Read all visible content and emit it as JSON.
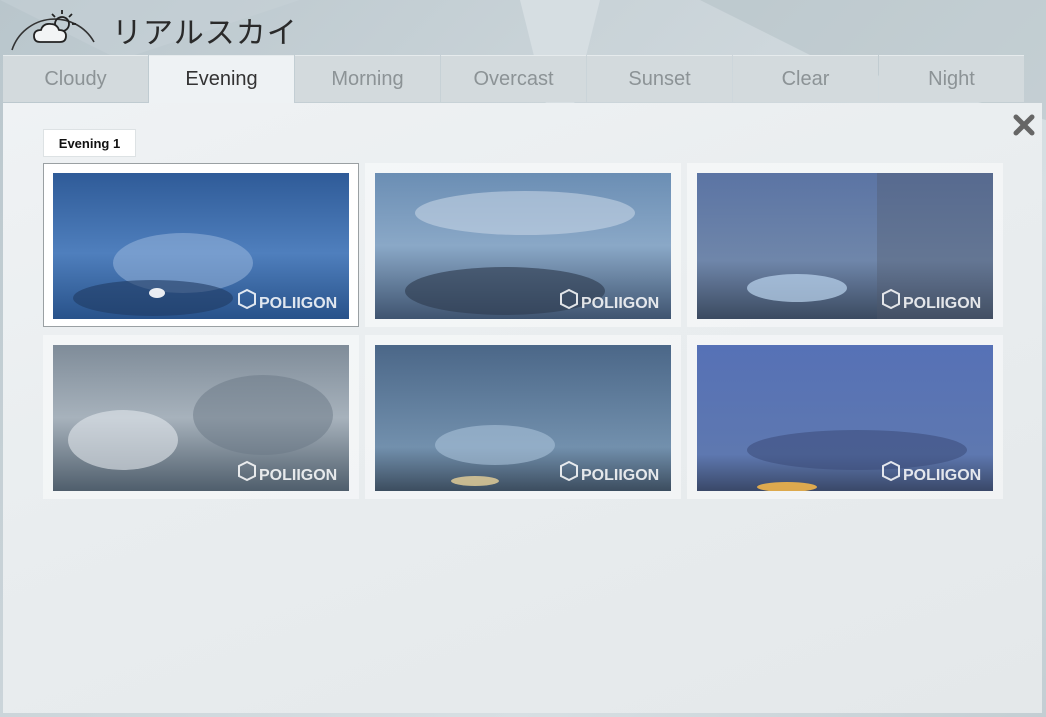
{
  "app": {
    "title": "リアルスカイ",
    "logo_icon": "cloud-sun-icon"
  },
  "tabs": [
    {
      "label": "Cloudy",
      "active": false
    },
    {
      "label": "Evening",
      "active": true
    },
    {
      "label": "Morning",
      "active": false
    },
    {
      "label": "Overcast",
      "active": false
    },
    {
      "label": "Sunset",
      "active": false
    },
    {
      "label": "Clear",
      "active": false
    },
    {
      "label": "Night",
      "active": false
    }
  ],
  "panel": {
    "group_label": "Evening 1",
    "close_icon": "close-icon",
    "thumbnails": [
      {
        "watermark": "POLIIGON",
        "selected": true,
        "sky_top": "#3d6aa8",
        "sky_bottom": "#2e5a97"
      },
      {
        "watermark": "POLIIGON",
        "selected": false,
        "sky_top": "#6f93b8",
        "sky_bottom": "#4e6f91"
      },
      {
        "watermark": "POLIIGON",
        "selected": false,
        "sky_top": "#5f78a6",
        "sky_bottom": "#566a86"
      },
      {
        "watermark": "POLIIGON",
        "selected": false,
        "sky_top": "#8795a3",
        "sky_bottom": "#5c6c7c"
      },
      {
        "watermark": "POLIIGON",
        "selected": false,
        "sky_top": "#4e6c8e",
        "sky_bottom": "#6f8aa6"
      },
      {
        "watermark": "POLIIGON",
        "selected": false,
        "sky_top": "#5a74b8",
        "sky_bottom": "#5f78b2"
      }
    ]
  }
}
